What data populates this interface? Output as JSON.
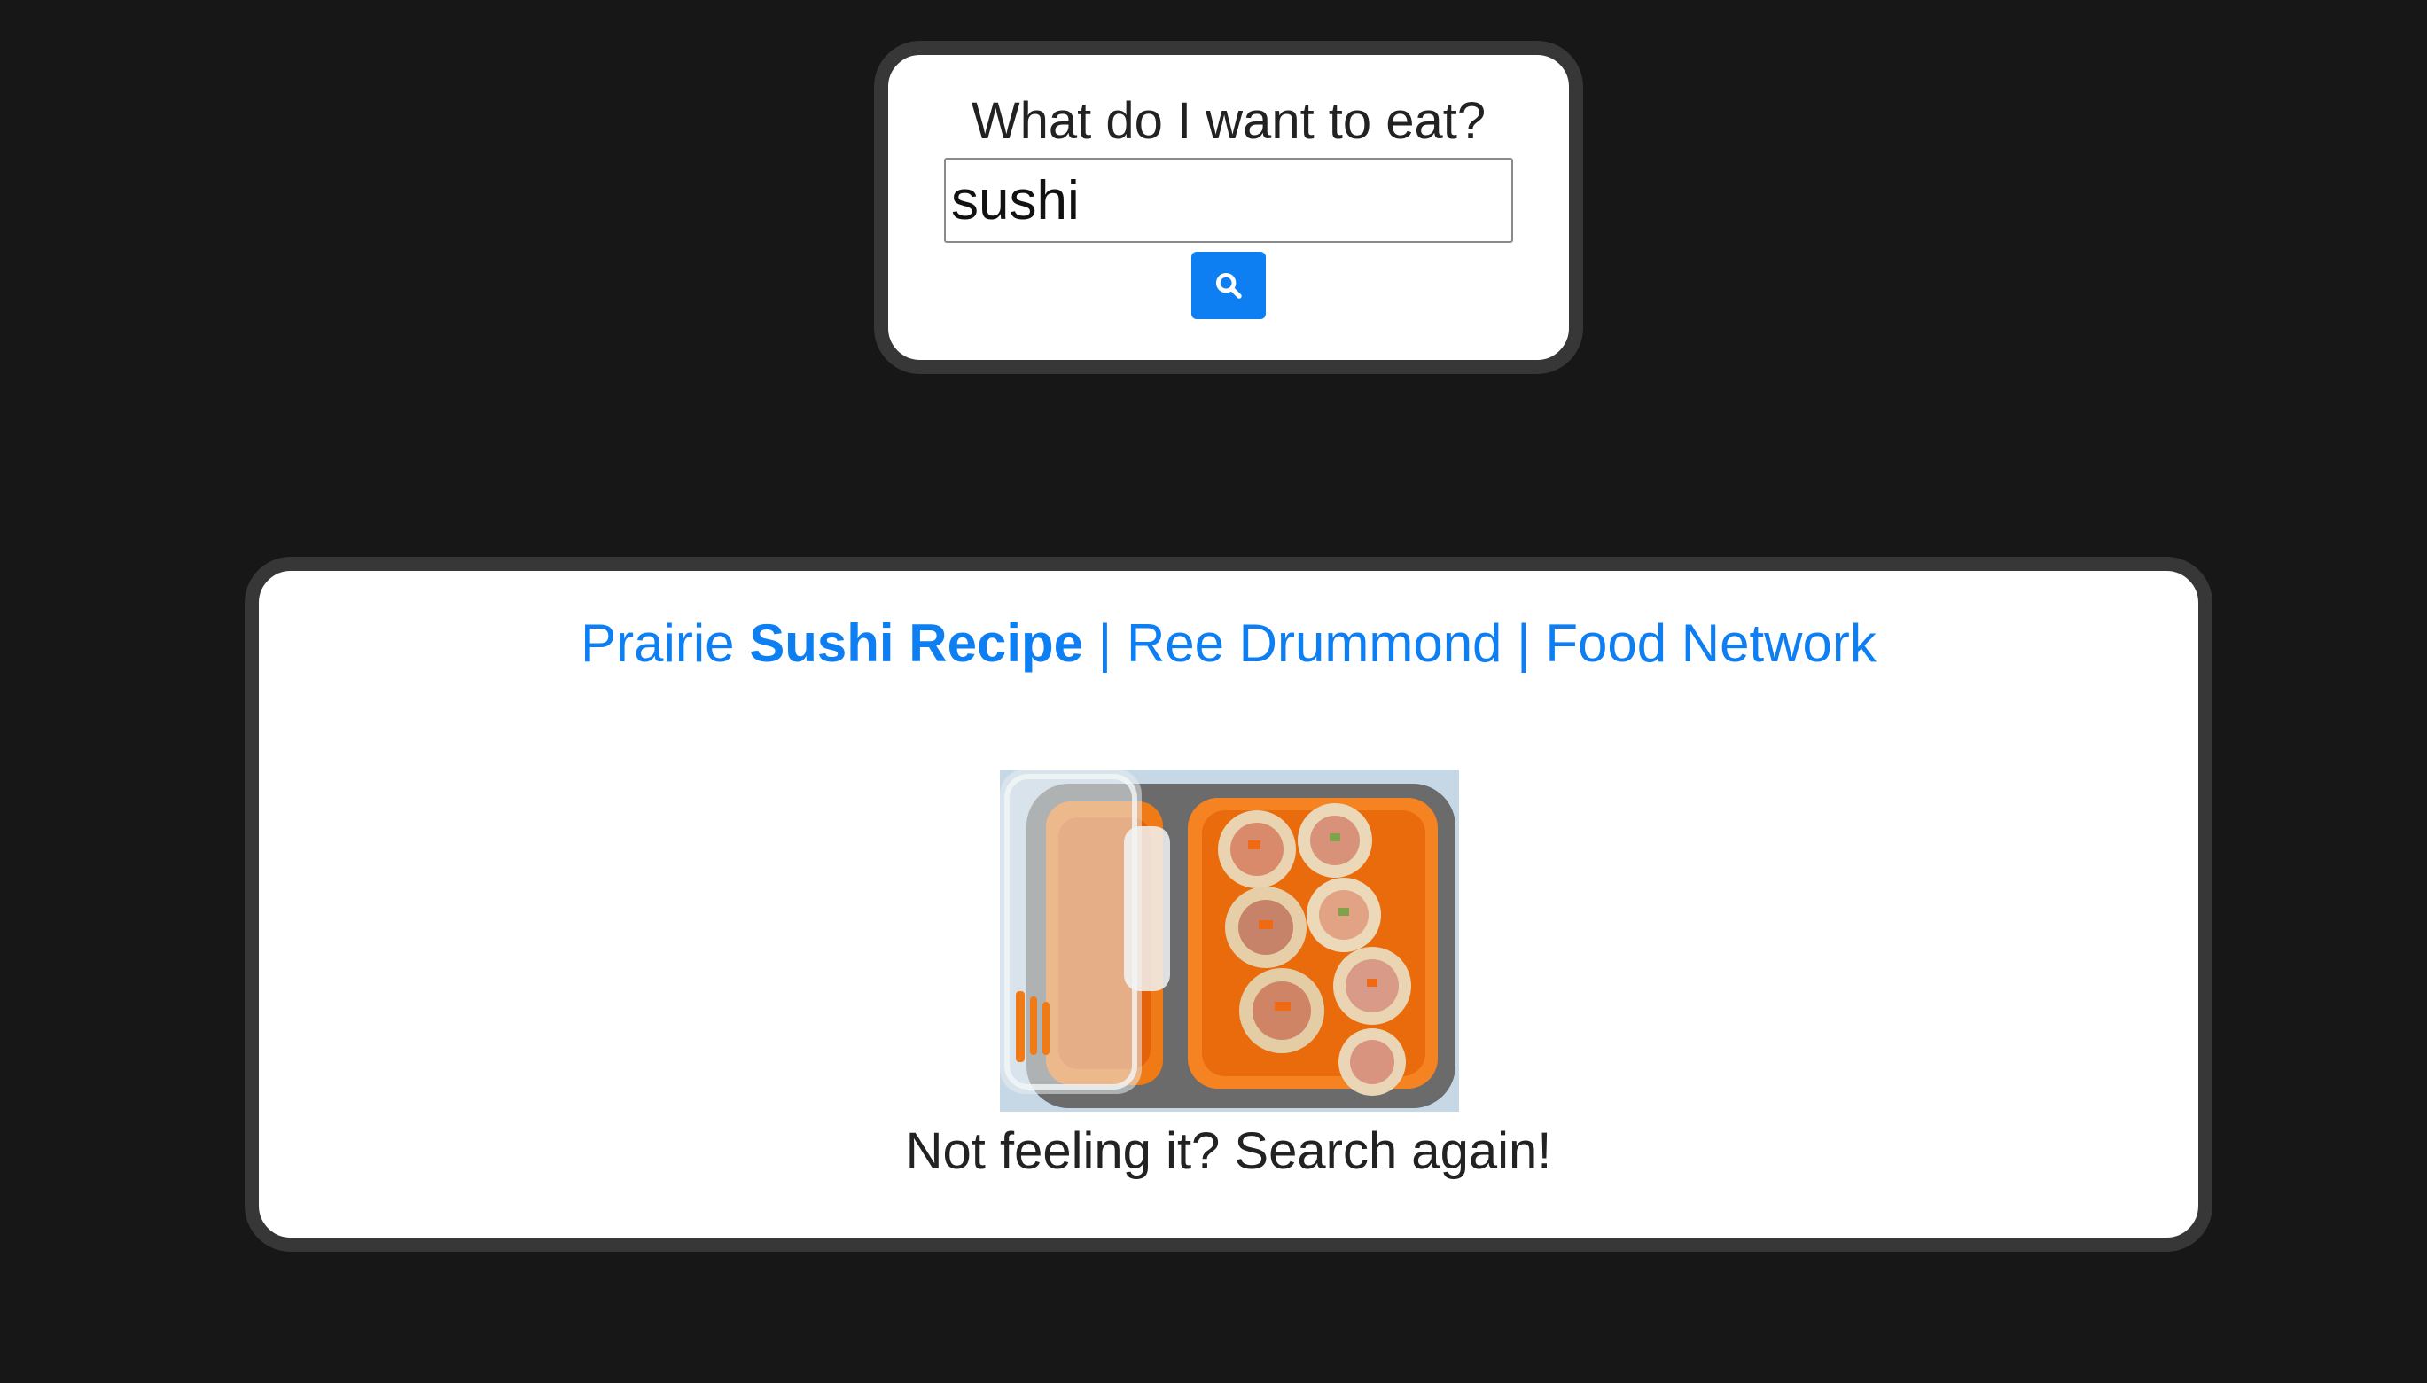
{
  "query": {
    "label": "What do I want to eat?",
    "input_value": "sushi",
    "search_icon": "search-icon"
  },
  "result": {
    "link_parts": {
      "before": "Prairie ",
      "bold": "Sushi Recipe",
      "after": " | Ree Drummond | Food Network"
    },
    "image_alt": "lunch box with sushi-style wraps",
    "retry_text": "Not feeling it? Search again!"
  },
  "colors": {
    "background": "#171717",
    "bubble_border": "#373737",
    "accent": "#0d7ff2",
    "text": "#222222"
  }
}
